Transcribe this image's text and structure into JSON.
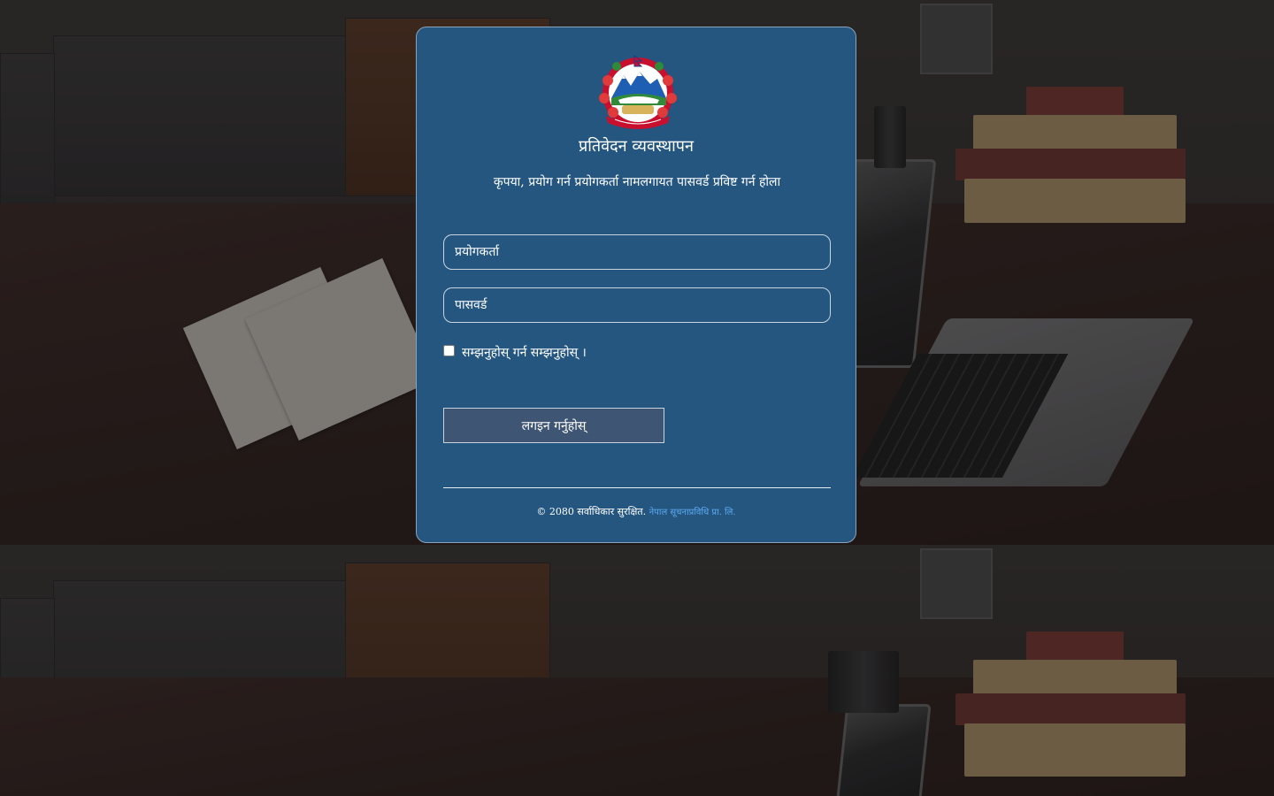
{
  "app": {
    "title": "प्रतिवेदन व्यवस्थापन",
    "subtitle": "कृपया, प्रयोग गर्न प्रयोगकर्ता नामलगायत पासवर्ड प्रविष्ट गर्न होला"
  },
  "emblem": {
    "icon": "nepal-government-emblem-icon"
  },
  "form": {
    "username_placeholder": "प्रयोगकर्ता",
    "password_placeholder": "पासवर्ड",
    "remember_label": "सम्झनुहोस् गर्न सम्झनुहोस् ।",
    "remember_checked": false,
    "submit_label": "लगइन गर्नुहोस्"
  },
  "footer": {
    "copyright": "© 2080 सर्वाधिकार सुरक्षित.",
    "link_text": "नेपाल सूचनाप्रविधि प्रा. लि."
  },
  "colors": {
    "card_background": "#24567f",
    "button_background": "#3e5573",
    "link": "#5da9f0"
  }
}
